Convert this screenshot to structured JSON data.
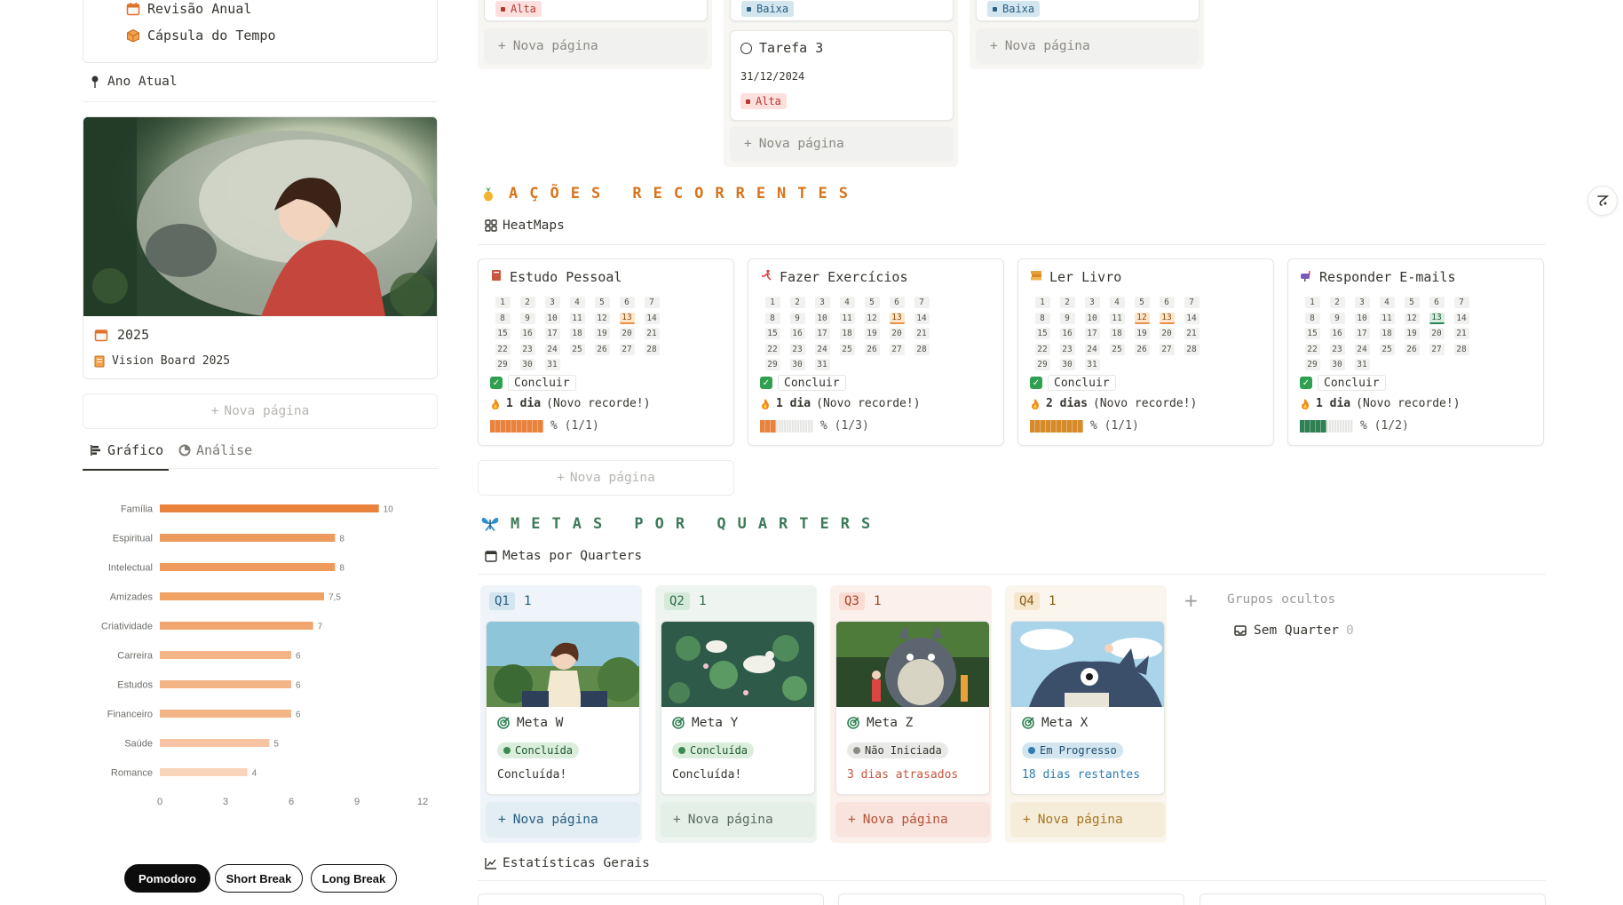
{
  "left": {
    "toc_items": [
      {
        "label": "Revisão Anual",
        "icon": "calendar-icon"
      },
      {
        "label": "Cápsula do Tempo",
        "icon": "box-icon"
      }
    ],
    "ano_atual": "Ano Atual",
    "cover_card": {
      "year": "2025",
      "link": "Vision Board 2025"
    },
    "new_page": "Nova página",
    "tabs": [
      "Gráfico",
      "Análise"
    ]
  },
  "chart_data": {
    "type": "bar",
    "orientation": "horizontal",
    "categories": [
      "Família",
      "Espiritual",
      "Intelectual",
      "Amizades",
      "Criatividade",
      "Carreira",
      "Estudos",
      "Financeiro",
      "Saúde",
      "Romance"
    ],
    "values": [
      10,
      8,
      8,
      7.5,
      7,
      6,
      6,
      6,
      5,
      4
    ],
    "value_labels": [
      "10",
      "8",
      "8",
      "7,5",
      "7",
      "6",
      "6",
      "6",
      "5",
      "4"
    ],
    "xlim": [
      0,
      12
    ],
    "xticks": [
      "0",
      "3",
      "6",
      "9",
      "12"
    ],
    "colors": [
      "#e9823d",
      "#ee9a5c",
      "#ee9a5c",
      "#f0a265",
      "#f0a66c",
      "#f3b486",
      "#f3b486",
      "#f3b486",
      "#f6c4a2",
      "#f8d4ba"
    ]
  },
  "pomodoro": [
    "Pomodoro",
    "Short Break",
    "Long Break"
  ],
  "kanban_top": {
    "col1": {
      "tag": "Alta",
      "new_page": "Nova página"
    },
    "col2": {
      "tag": "Baixa",
      "card_title": "Tarefa 3",
      "card_date": "31/12/2024",
      "card_tag": "Alta",
      "new_page": "Nova página"
    },
    "col3": {
      "tag": "Baixa",
      "new_page": "Nova página"
    }
  },
  "acoes": {
    "title": "AÇÕES RECORRENTES",
    "view": "HeatMaps",
    "concluir": "Concluir",
    "cards": [
      {
        "name": "Estudo Pessoal",
        "icon": "book-icon",
        "streak_bold": "1 dia",
        "streak_note": "(Novo recorde!)",
        "progress": "% (1/1)",
        "fraction": 1.0,
        "color": "#e9823d",
        "highlight": [
          13
        ],
        "hl_type": "orange"
      },
      {
        "name": "Fazer Exercícios",
        "icon": "runner-icon",
        "streak_bold": "1 dia",
        "streak_note": "(Novo recorde!)",
        "progress": "% (1/3)",
        "fraction": 0.333,
        "color": "#e9823d",
        "highlight": [
          13
        ],
        "hl_type": "orange"
      },
      {
        "name": "Ler Livro",
        "icon": "book-stack-icon",
        "streak_bold": "2 dias",
        "streak_note": "(Novo recorde!)",
        "progress": "% (1/1)",
        "fraction": 1.0,
        "color": "#d68a2a",
        "highlight": [
          12,
          13
        ],
        "hl_type": "orange"
      },
      {
        "name": "Responder E-mails",
        "icon": "mailbox-icon",
        "streak_bold": "1 dia",
        "streak_note": "(Novo recorde!)",
        "progress": "% (1/2)",
        "fraction": 0.5,
        "color": "#2f8053",
        "highlight": [
          13
        ],
        "hl_type": "green"
      }
    ],
    "new_page": "Nova página"
  },
  "metas": {
    "title": "METAS POR QUARTERS",
    "view": "Metas por Quarters",
    "quarters": [
      {
        "q": "Q1",
        "count": "1",
        "name": "Meta W",
        "status": "Concluída",
        "note": "Concluída!",
        "new_page": "Nova página"
      },
      {
        "q": "Q2",
        "count": "1",
        "name": "Meta Y",
        "status": "Concluída",
        "note": "Concluída!",
        "new_page": "Nova página"
      },
      {
        "q": "Q3",
        "count": "1",
        "name": "Meta Z",
        "status": "Não Iniciada",
        "note": "3 dias atrasados",
        "new_page": "Nova página"
      },
      {
        "q": "Q4",
        "count": "1",
        "name": "Meta X",
        "status": "Em Progresso",
        "note": "18 dias restantes",
        "new_page": "Nova página"
      }
    ],
    "hidden_groups": "Grupos ocultos",
    "sem_quarter": "Sem Quarter",
    "sem_quarter_count": "0"
  },
  "estatisticas": "Estatísticas Gerais"
}
